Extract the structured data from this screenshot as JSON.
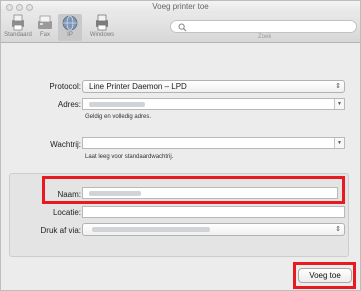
{
  "window": {
    "title": "Voeg printer toe"
  },
  "toolbar": {
    "items": [
      {
        "label": "Standaard",
        "icon": "printer-default-icon"
      },
      {
        "label": "Fax",
        "icon": "fax-icon"
      },
      {
        "label": "IP",
        "icon": "globe-icon"
      },
      {
        "label": "Windows",
        "icon": "windows-printer-icon"
      }
    ],
    "selected": "IP",
    "search_placeholder": "",
    "search_label": "Zoek"
  },
  "form": {
    "protocol_label": "Protocol:",
    "protocol_value": "Line Printer Daemon – LPD",
    "address_label": "Adres:",
    "address_hint": "Geldig en volledig adres.",
    "queue_label": "Wachtrij:",
    "queue_value": "",
    "queue_hint": "Laat leeg voor standaardwachtrij.",
    "name_label": "Naam:",
    "location_label": "Locatie:",
    "location_value": "",
    "use_label": "Druk af via:"
  },
  "footer": {
    "add_button": "Voeg toe"
  },
  "colors": {
    "highlight": "#e8191f",
    "window_bg": "#ececec"
  }
}
